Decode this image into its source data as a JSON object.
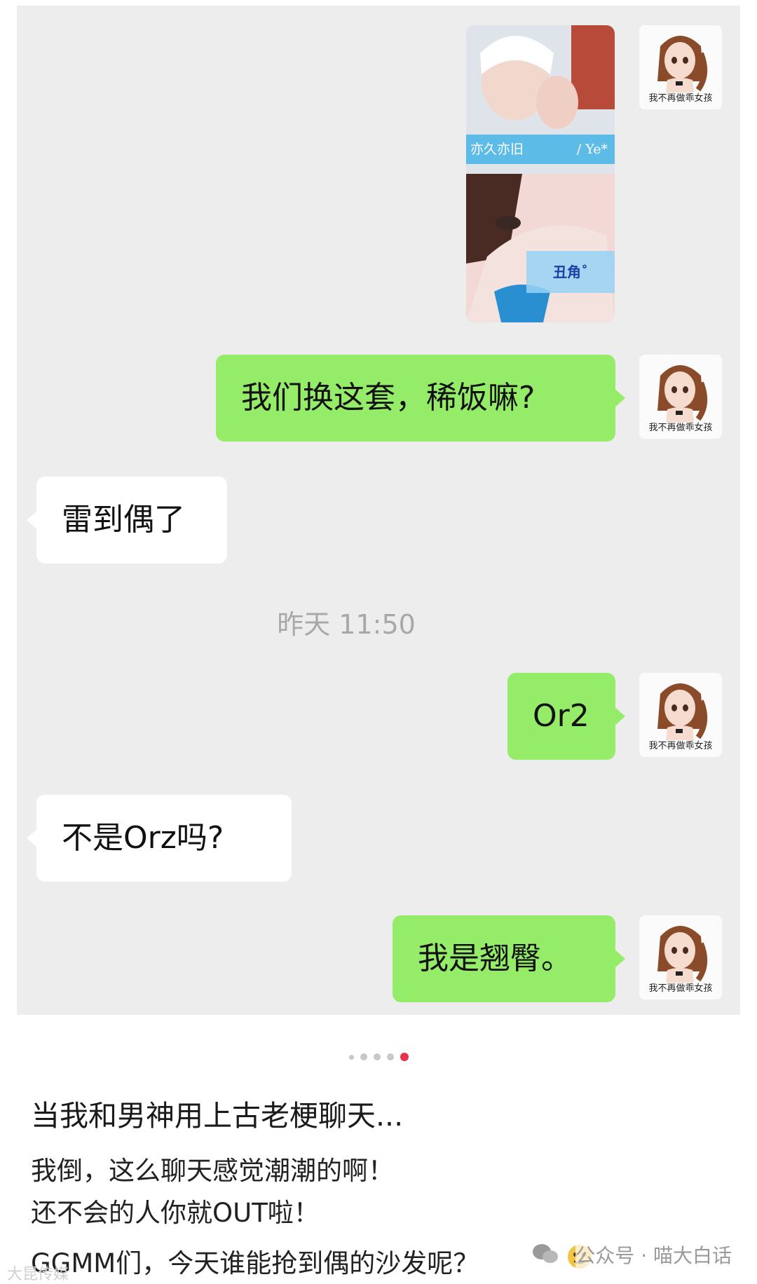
{
  "chat": {
    "avatar_caption": "我不再做乖女孩",
    "image_message": {
      "top_caption_left": "亦久亦旧",
      "top_caption_right": "/ Ye*",
      "bottom_tag": "丑角˚"
    },
    "messages": [
      {
        "side": "me",
        "text": "我们换这套，稀饭嘛?"
      },
      {
        "side": "other",
        "text": "雷到偶了"
      },
      {
        "side": "me",
        "text": "Or2"
      },
      {
        "side": "other",
        "text": "不是Orz吗?"
      },
      {
        "side": "me",
        "text": "我是翘臀。"
      }
    ],
    "timestamp": "昨天 11:50"
  },
  "pager": {
    "total": 5,
    "active_index": 4
  },
  "post": {
    "title": "当我和男神用上古老梗聊天...",
    "lines": [
      "我倒，这么聊天感觉潮潮的啊！",
      "还不会的人你就OUT啦！",
      "GGMM们，今天谁能抢到偶的沙发呢？"
    ]
  },
  "watermarks": {
    "right": "公众号 · 喵大白话",
    "left": "大昆传媒"
  },
  "colors": {
    "chat_bg": "#ededed",
    "my_bubble": "#95ec69",
    "other_bubble": "#ffffff",
    "pager_active": "#e8344a"
  }
}
